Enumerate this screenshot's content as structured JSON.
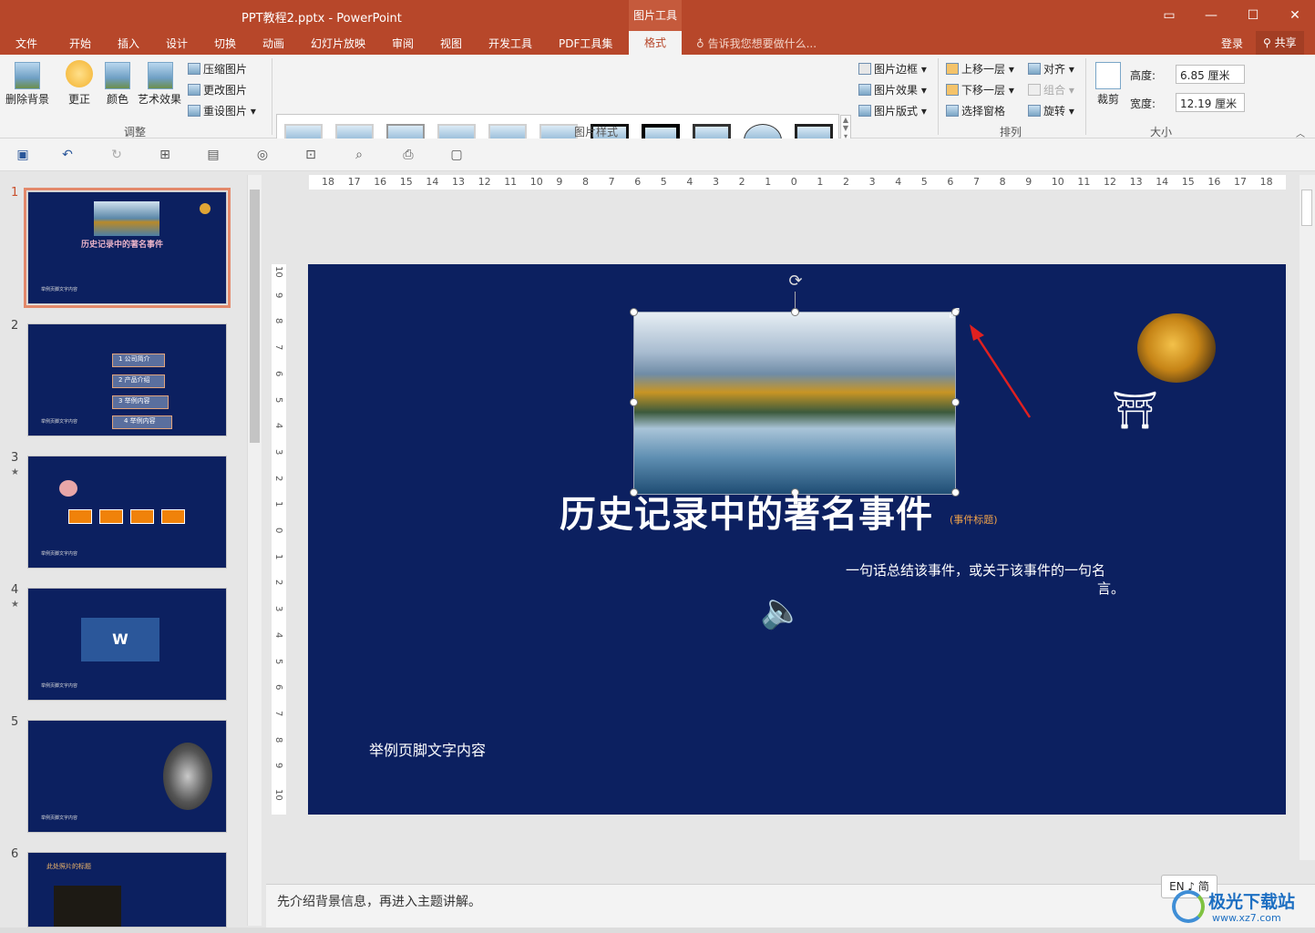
{
  "window": {
    "title": "PPT教程2.pptx - PowerPoint",
    "context_tool": "图片工具"
  },
  "tabs": [
    "文件",
    "开始",
    "插入",
    "设计",
    "切换",
    "动画",
    "幻灯片放映",
    "审阅",
    "视图",
    "开发工具",
    "PDF工具集"
  ],
  "active_tab": "格式",
  "tell_me": "告诉我您想要做什么...",
  "account": {
    "login": "登录",
    "share": "共享"
  },
  "ribbon": {
    "adjust": {
      "remove_bg": "删除背景",
      "corrections": "更正",
      "color": "颜色",
      "artistic": "艺术效果",
      "compress": "压缩图片",
      "change": "更改图片",
      "reset": "重设图片",
      "label": "调整"
    },
    "styles": {
      "border": "图片边框",
      "effects": "图片效果",
      "layout": "图片版式",
      "label": "图片样式"
    },
    "arrange": {
      "bring_forward": "上移一层",
      "send_backward": "下移一层",
      "selection_pane": "选择窗格",
      "align": "对齐",
      "group": "组合",
      "rotate": "旋转",
      "label": "排列"
    },
    "size": {
      "crop": "裁剪",
      "height_label": "高度:",
      "height_value": "6.85 厘米",
      "width_label": "宽度:",
      "width_value": "12.19 厘米",
      "label": "大小"
    }
  },
  "thumbnails": [
    {
      "num": "1",
      "title": "历史记录中的著名事件",
      "footer": "举例页脚文字内容"
    },
    {
      "num": "2",
      "items": [
        "1 公司简介",
        "2 产品介绍",
        "3 举例内容",
        "4 举例内容"
      ],
      "footer": "举例页脚文字内容"
    },
    {
      "num": "3",
      "star": "★",
      "footer": "举例页脚文字内容"
    },
    {
      "num": "4",
      "star": "★",
      "footer": "举例页脚文字内容"
    },
    {
      "num": "5",
      "footer": "举例页脚文字内容"
    },
    {
      "num": "6",
      "title": "此处照片的标题"
    }
  ],
  "hruler_labels": [
    "18",
    "17",
    "16",
    "15",
    "14",
    "13",
    "12",
    "11",
    "10",
    "9",
    "8",
    "7",
    "6",
    "5",
    "4",
    "3",
    "2",
    "1",
    "0",
    "1",
    "2",
    "3",
    "4",
    "5",
    "6",
    "7",
    "8",
    "9",
    "10",
    "11",
    "12",
    "13",
    "14",
    "15",
    "16",
    "17",
    "18"
  ],
  "vruler_labels": [
    "10",
    "9",
    "8",
    "7",
    "6",
    "5",
    "4",
    "3",
    "2",
    "1",
    "0",
    "1",
    "2",
    "3",
    "4",
    "5",
    "6",
    "7",
    "8",
    "9",
    "10"
  ],
  "slide": {
    "title": "历史记录中的著名事件",
    "subtitle_tag": "(事件标题)",
    "quote_line1": "一句话总结该事件，或关于该事件的一句名",
    "quote_line2": "言。",
    "footer": "举例页脚文字内容"
  },
  "notes": "先介绍背景信息，再进入主题讲解。",
  "ime": "EN ♪ 简",
  "watermark": {
    "name": "极光下载站",
    "url": "www.xz7.com"
  }
}
